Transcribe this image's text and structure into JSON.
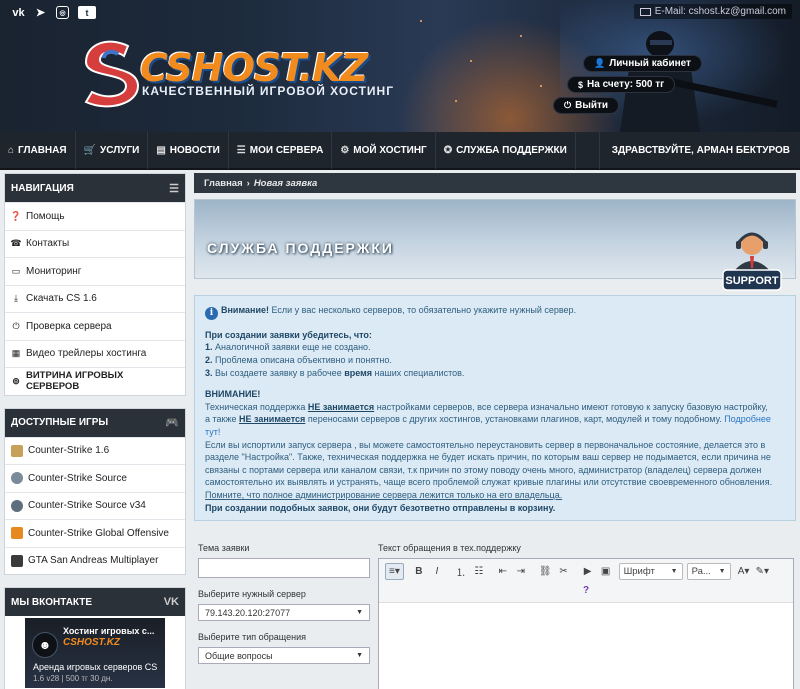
{
  "header": {
    "social": [
      "vk-icon",
      "telegram-icon",
      "instagram-icon",
      "tumblr-icon"
    ],
    "email": "E-Mail: cshost.kz@gmail.com",
    "logo_text": "CSHOST.KZ",
    "logo_sub": "КАЧЕСТВЕННЫЙ ИГРОВОЙ ХОСТИНГ",
    "cabinet": "Личный кабинет",
    "balance": "На счету: 500 тг",
    "logout": "Выйти"
  },
  "nav": {
    "items": [
      {
        "label": "ГЛАВНАЯ",
        "icon": "home-icon"
      },
      {
        "label": "УСЛУГИ",
        "icon": "cart-icon"
      },
      {
        "label": "НОВОСТИ",
        "icon": "newspaper-icon"
      },
      {
        "label": "МОИ СЕРВЕРА",
        "icon": "list-icon"
      },
      {
        "label": "МОЙ ХОСТИНГ",
        "icon": "cogs-icon"
      },
      {
        "label": "СЛУЖБА ПОДДЕРЖКИ",
        "icon": "lifebuoy-icon"
      }
    ],
    "greeting": "ЗДРАВСТВУЙТЕ, АРМАН БЕКТУРОВ"
  },
  "sidebar": {
    "navigation": {
      "title": "НАВИГАЦИЯ",
      "items": [
        "Помощь",
        "Контакты",
        "Мониторинг",
        "Скачать CS 1.6",
        "Проверка сервера",
        "Видео трейлеры хостинга",
        "ВИТРИНА ИГРОВЫХ СЕРВЕРОВ"
      ]
    },
    "games": {
      "title": "ДОСТУПНЫЕ ИГРЫ",
      "items": [
        "Counter-Strike 1.6",
        "Counter-Strike Source",
        "Counter-Strike Source v34",
        "Counter-Strike Global Offensive",
        "GTA San Andreas Multiplayer"
      ]
    },
    "vk": {
      "title": "МЫ ВКОНТАКТЕ",
      "card_title": "Хостинг игровых с...",
      "card_logo": "CSHOST.KZ",
      "card_line1": "Аренда игровых серверов CS",
      "card_line2": "1.6 v28 | 500 тг 30 дн."
    }
  },
  "main": {
    "breadcrumb": {
      "home": "Главная",
      "sep": "›",
      "current": "Новая заявка"
    },
    "banner_title": "СЛУЖБА ПОДДЕРЖКИ",
    "support_badge": "SUPPORT",
    "info": {
      "attention_label": "Внимание!",
      "attention_text": " Если у вас несколько серверов, то обязательно укажите нужный сервер.",
      "checklist_title": "При создании заявки убедитесь, что:",
      "check1_num": "1.",
      "check1": " Аналогичной заявки еще не создано.",
      "check2_num": "2.",
      "check2": " Проблема описана объективно и понятно.",
      "check3_num": "3.",
      "check3a": " Вы создаете заявку в рабочее ",
      "check3b": "время",
      "check3c": " наших специалистов.",
      "warning_title": "ВНИМАНИЕ!",
      "w1a": "Техническая поддержка ",
      "w1b": "НЕ занимается",
      "w1c": " настройками серверов, все сервера изначально имеют готовую к запуску базовую настройку,",
      "w2a": "а также ",
      "w2b": "НЕ занимается",
      "w2c": " переносами серверов с других хостингов, установками плагинов, карт, модулей и тому подобному. ",
      "w2link": "Подробнее тут!",
      "w3": "Если вы испортили запуск сервера , вы можете самостоятельно переустановить сервер в первоначальное состояние, делается это в",
      "w4": "разделе \"Настройка\". Также, техническая поддержка не будет искать причин, по которым ваш сервер не подымается, если причина не",
      "w5": "связаны с портами сервера или каналом связи, т.к причин по этому поводу очень много, администратор (владелец) сервера должен",
      "w6": "самостоятельно их выявлять и устранять, чаще всего проблемой служат кривые плагины или отсутствие своевременного обновления.",
      "w7": "Помните, что полное администрирование сервера лежится только на его владельца.",
      "w8": "При создании подобных заявок, они будут безответно отправлены в корзину."
    },
    "form": {
      "subject_label": "Тема заявки",
      "subject_value": "",
      "server_label": "Выберите нужный сервер",
      "server_value": "79.143.20.120:27077",
      "type_label": "Выберите тип обращения",
      "type_value": "Общие вопросы",
      "text_label": "Текст обращения в тех.поддержку",
      "font_select": "Шрифт",
      "size_select": "Ра..."
    }
  },
  "colors": {
    "accent_orange": "#f28b1e",
    "nav_bg": "#1f252d",
    "info_bg": "#dbeaf4",
    "info_text": "#2f5e80"
  }
}
